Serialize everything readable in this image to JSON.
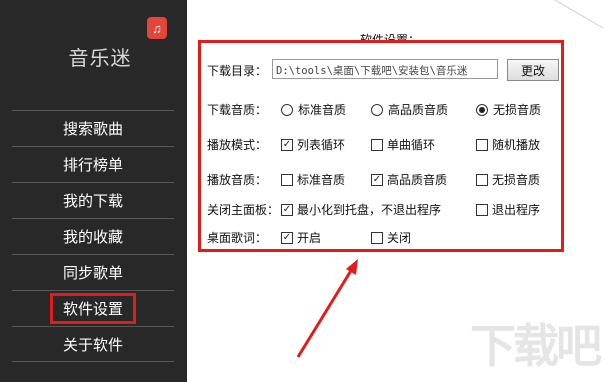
{
  "app": {
    "title": "音乐迷",
    "logo_icon": "music-note-icon"
  },
  "sidebar": {
    "items": [
      {
        "label": "搜索歌曲",
        "active": false
      },
      {
        "label": "排行榜单",
        "active": false
      },
      {
        "label": "我的下载",
        "active": false
      },
      {
        "label": "我的收藏",
        "active": false
      },
      {
        "label": "同步歌单",
        "active": false
      },
      {
        "label": "软件设置",
        "active": true
      },
      {
        "label": "关于软件",
        "active": false
      }
    ]
  },
  "settings": {
    "title": "软件设置：",
    "download_dir": {
      "label": "下载目录：",
      "value": "D:\\tools\\桌面\\下载吧\\安装包\\音乐迷",
      "button": "更改"
    },
    "download_quality": {
      "label": "下载音质：",
      "options": [
        "标准音质",
        "高品质音质",
        "无损音质"
      ],
      "selected": 2
    },
    "play_mode": {
      "label": "播放模式：",
      "options": [
        "列表循环",
        "单曲循环",
        "随机播放"
      ],
      "checked": [
        true,
        false,
        false
      ]
    },
    "play_quality": {
      "label": "播放音质：",
      "options": [
        "标准音质",
        "高品质音质",
        "无损音质"
      ],
      "checked": [
        false,
        true,
        false
      ]
    },
    "close_panel": {
      "label": "关闭主面板：",
      "options": [
        "最小化到托盘，不退出程序",
        "退出程序"
      ],
      "checked": [
        true,
        false
      ]
    },
    "desktop_lyrics": {
      "label": "桌面歌词：",
      "options": [
        "开启",
        "关闭"
      ],
      "checked": [
        true,
        false
      ]
    }
  },
  "colors": {
    "sidebar_bg": "#282828",
    "highlight_red": "#e21b1b",
    "logo_red": "#e0463a"
  },
  "watermark": {
    "text": "下载吧"
  }
}
